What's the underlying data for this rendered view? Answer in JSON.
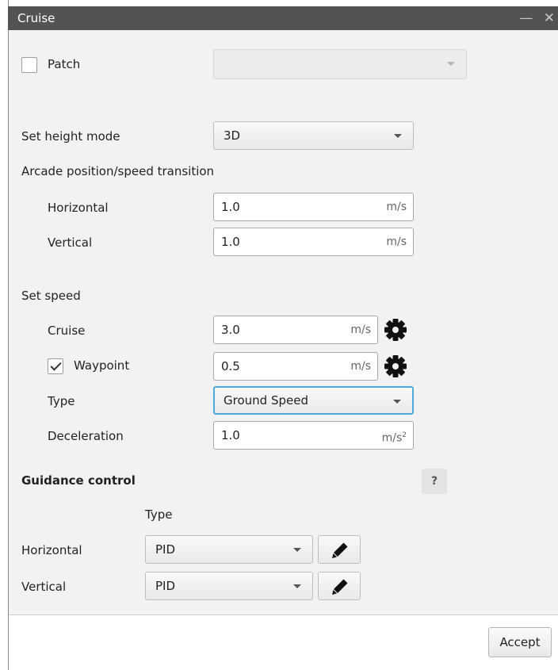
{
  "window": {
    "title": "Cruise",
    "controls": "— ✕"
  },
  "patch": {
    "label": "Patch",
    "checked": false,
    "combo_value": ""
  },
  "height_mode": {
    "label": "Set height mode",
    "value": "3D"
  },
  "arcade": {
    "section_label": "Arcade position/speed transition",
    "horizontal": {
      "label": "Horizontal",
      "value": "1.0",
      "unit": "m/s"
    },
    "vertical": {
      "label": "Vertical",
      "value": "1.0",
      "unit": "m/s"
    }
  },
  "set_speed": {
    "section_label": "Set speed",
    "cruise": {
      "label": "Cruise",
      "value": "3.0",
      "unit": "m/s"
    },
    "waypoint": {
      "label": "Waypoint",
      "checked": true,
      "value": "0.5",
      "unit": "m/s"
    },
    "type": {
      "label": "Type",
      "value": "Ground Speed"
    },
    "deceleration": {
      "label": "Deceleration",
      "value": "1.0",
      "unit": "m/s",
      "unit_exp": "2"
    }
  },
  "guidance": {
    "section_label": "Guidance control",
    "help": "?",
    "type_header": "Type",
    "horizontal": {
      "label": "Horizontal",
      "value": "PID"
    },
    "vertical": {
      "label": "Vertical",
      "value": "PID"
    }
  },
  "footer": {
    "accept_label": "Accept"
  },
  "colors": {
    "titlebar": "#535353",
    "focus_border": "#4fa8d8",
    "content_bg": "#f2f2f2"
  }
}
